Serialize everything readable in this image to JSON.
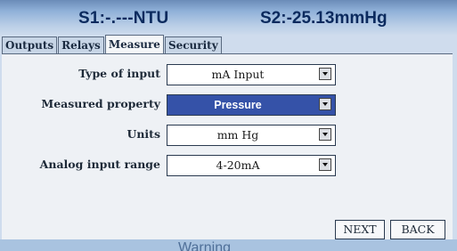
{
  "status": {
    "sensor1": "S1:-.---NTU",
    "sensor2": "S2:-25.13mmHg"
  },
  "tabs": [
    {
      "label": "Outputs",
      "active": false
    },
    {
      "label": "Relays",
      "active": false
    },
    {
      "label": "Measure",
      "active": true
    },
    {
      "label": "Security",
      "active": false
    }
  ],
  "fields": [
    {
      "label": "Type of input",
      "value": "mA Input",
      "selected": false
    },
    {
      "label": "Measured property",
      "value": "Pressure",
      "selected": true
    },
    {
      "label": "Units",
      "value": "mm Hg",
      "selected": false
    },
    {
      "label": "Analog input range",
      "value": "4-20mA",
      "selected": false
    }
  ],
  "buttons": {
    "next": "NEXT",
    "back": "BACK"
  },
  "footer": {
    "warning": "Warning"
  },
  "colors": {
    "selected_field": "#3552a8",
    "header_text": "#0b2a5e"
  }
}
